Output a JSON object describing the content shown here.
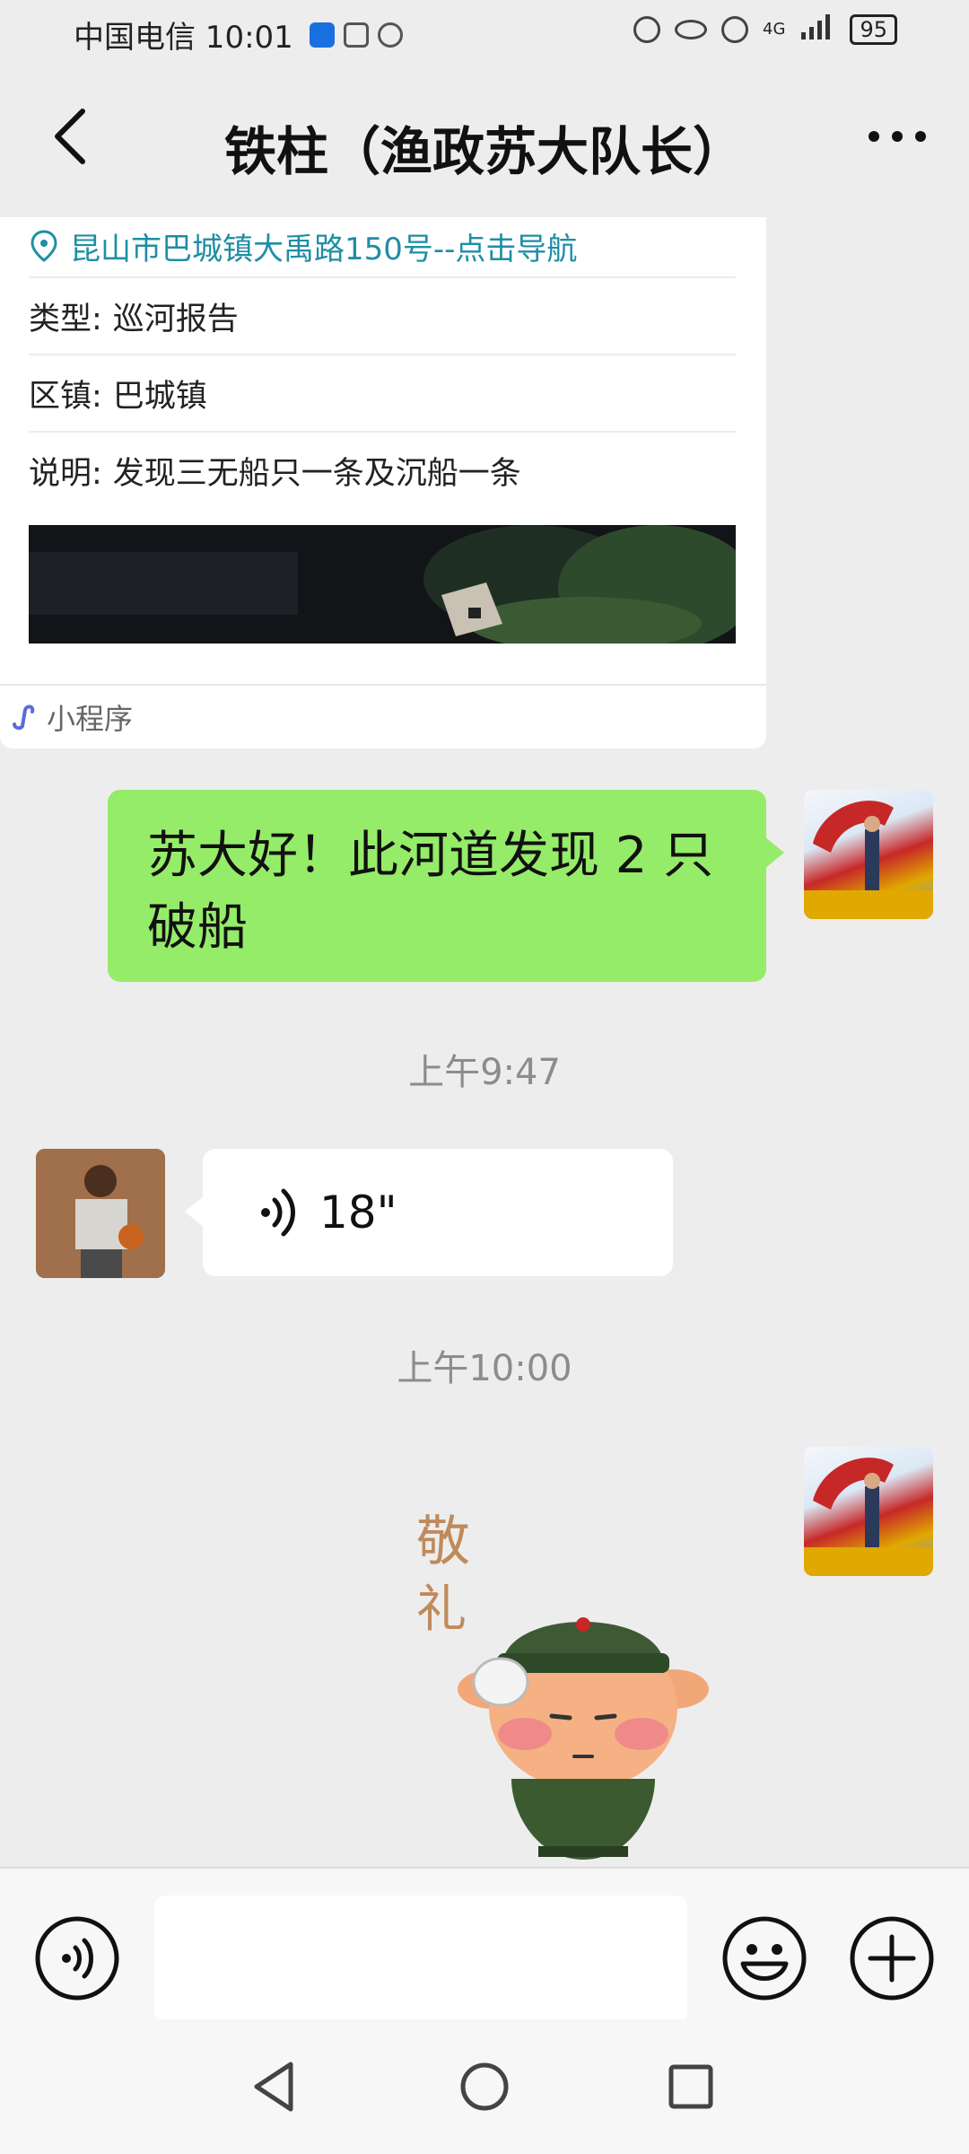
{
  "status_bar": {
    "carrier_time": "中国电信 10:01",
    "battery": "95",
    "network": "4G"
  },
  "header": {
    "title": "铁柱（渔政苏大队长）"
  },
  "mini_program_card": {
    "address": "昆山市巴城镇大禹路150号--点击导航",
    "rows": [
      {
        "label": "类型:",
        "value": "巡河报告"
      },
      {
        "label": "区镇:",
        "value": "巴城镇"
      },
      {
        "label": "说明:",
        "value": "发现三无船只一条及沉船一条"
      }
    ],
    "footer_label": "小程序"
  },
  "messages": {
    "sent_text": "苏大好！此河道发现 2 只破船",
    "timestamp_1": "上午9:47",
    "voice_duration": "18\"",
    "timestamp_2": "上午10:00",
    "sticker_text": "敬礼"
  },
  "input_bar": {
    "placeholder": ""
  },
  "colors": {
    "background": "#ededed",
    "sent_bubble": "#95ec69",
    "link_teal": "#1f8ea5",
    "timestamp_gray": "#8c8c8c"
  }
}
